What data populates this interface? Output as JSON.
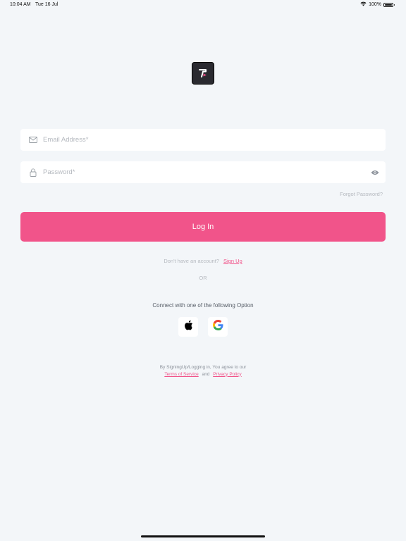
{
  "status_bar": {
    "time": "10:04 AM",
    "date": "Tue 16 Jul",
    "battery": "100%"
  },
  "form": {
    "email_placeholder": "Email Address*",
    "password_placeholder": "Password*",
    "forgot_label": "Forgot Password?",
    "login_label": "Log In"
  },
  "signup": {
    "prompt": "Don't have an account?",
    "link": "Sign Up"
  },
  "divider": "OR",
  "social": {
    "heading": "Connect with one of the following Option"
  },
  "legal": {
    "line1": "By SigningUp/Logging in, You agree to our",
    "terms": "Terms of Service",
    "and": "and",
    "privacy": "Privacy Policy"
  },
  "colors": {
    "accent": "#f1548a",
    "background": "#f3f6f9",
    "logo_bg": "#2a2a30"
  },
  "icons": [
    "wifi-icon",
    "battery-icon",
    "app-logo",
    "mail-icon",
    "lock-icon",
    "eye-icon",
    "apple-icon",
    "google-icon"
  ]
}
